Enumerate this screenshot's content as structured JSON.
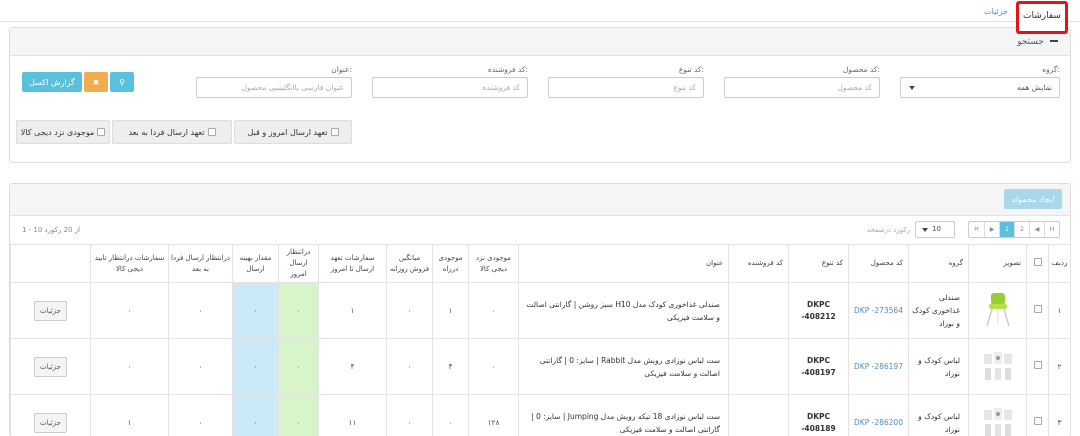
{
  "tabs": {
    "active": "سفارشات",
    "other": "جزئیات"
  },
  "search": {
    "title": "جستجو",
    "group_label": "گروه:",
    "group_value": "نمایش همه",
    "product_code_label": "کد محصول:",
    "product_code_ph": "کد محصول",
    "variant_code_label": "کد تنوع:",
    "variant_code_ph": "کد تنوع",
    "seller_code_label": "کد فروشنده:",
    "seller_code_ph": "کد فروشنده",
    "title_label": "عنوان:",
    "title_ph": "عنوان فارسی یاانگلیسی محصول",
    "excel_btn": "گزارش اکسل",
    "chk_today": "تعهد ارسال امروز و قبل",
    "chk_tomorrow": "تعهد ارسال فردا به بعد",
    "chk_stock": "موجودی نزد دیجی کالا"
  },
  "list": {
    "create_btn": "ایجاد محموله",
    "records": "1 - 10 از 20 رکورد",
    "per_page_label": "رکورد درصفحه",
    "per_page": "10",
    "pages": [
      "H",
      "◀",
      "2",
      "1",
      "▶",
      "H"
    ],
    "headers": [
      "ردیف",
      "",
      "تصویر",
      "گروه",
      "کد محصول",
      "کد تنوع",
      "کد فروشنده",
      "عنوان",
      "موجودی نزد دیجی کالا",
      "موجودی درراه",
      "میانگین فروش روزانه",
      "سفارشات تعهد ارسال تا امروز",
      "درانتظار ارسال امروز",
      "مقدار بهینه ارسال",
      "درانتظار ارسال فردا به بعد",
      "سفارشات درانتظار تایید دیجی کالا",
      ""
    ],
    "rows": [
      {
        "n": "۱",
        "group": "صندلی غذاخوری کودک و نوزاد",
        "pcode": "DKP -273564",
        "vcode": "DKPC -408212",
        "seller": "",
        "title": "صندلی غذاخوری کودک مدل H10 سبز روشن | گارانتی اصالت و سلامت فیزیکی",
        "stock": "۰",
        "road": "۱",
        "avg": "۰",
        "commit": "۱",
        "today": "۰",
        "opt": "۰",
        "tomorrow": "۰",
        "pending": "۰",
        "detail": "جزئیات"
      },
      {
        "n": "۲",
        "group": "لباس کودک و نوزاد",
        "pcode": "DKP -286197",
        "vcode": "DKPC -408197",
        "seller": "",
        "title": "ست لباس نوزادی رویش مدل Rabbit | سایز: 0 | گارانتی اصالت و سلامت فیزیکی",
        "stock": "۰",
        "road": "۴",
        "avg": "۰",
        "commit": "۴",
        "today": "۰",
        "opt": "۰",
        "tomorrow": "۰",
        "pending": "۰",
        "detail": "جزئیات"
      },
      {
        "n": "۳",
        "group": "لباس کودک و نوزاد",
        "pcode": "DKP -286200",
        "vcode": "DKPC -408189",
        "seller": "",
        "title": "ست لباس نوزادی 18 تیکه رویش مدل Jumping | سایز: 0 | گارانتی اصالت و سلامت فیزیکی",
        "stock": "۱۲۸",
        "road": "۰",
        "avg": "۰",
        "commit": "۱۱",
        "today": "۰",
        "opt": "۰",
        "tomorrow": "۰",
        "pending": "۱",
        "detail": "جزئیات"
      }
    ]
  },
  "colors": {
    "accent": "#5bc0de",
    "orange": "#f0ad4e",
    "highlight": "#e0141b"
  }
}
